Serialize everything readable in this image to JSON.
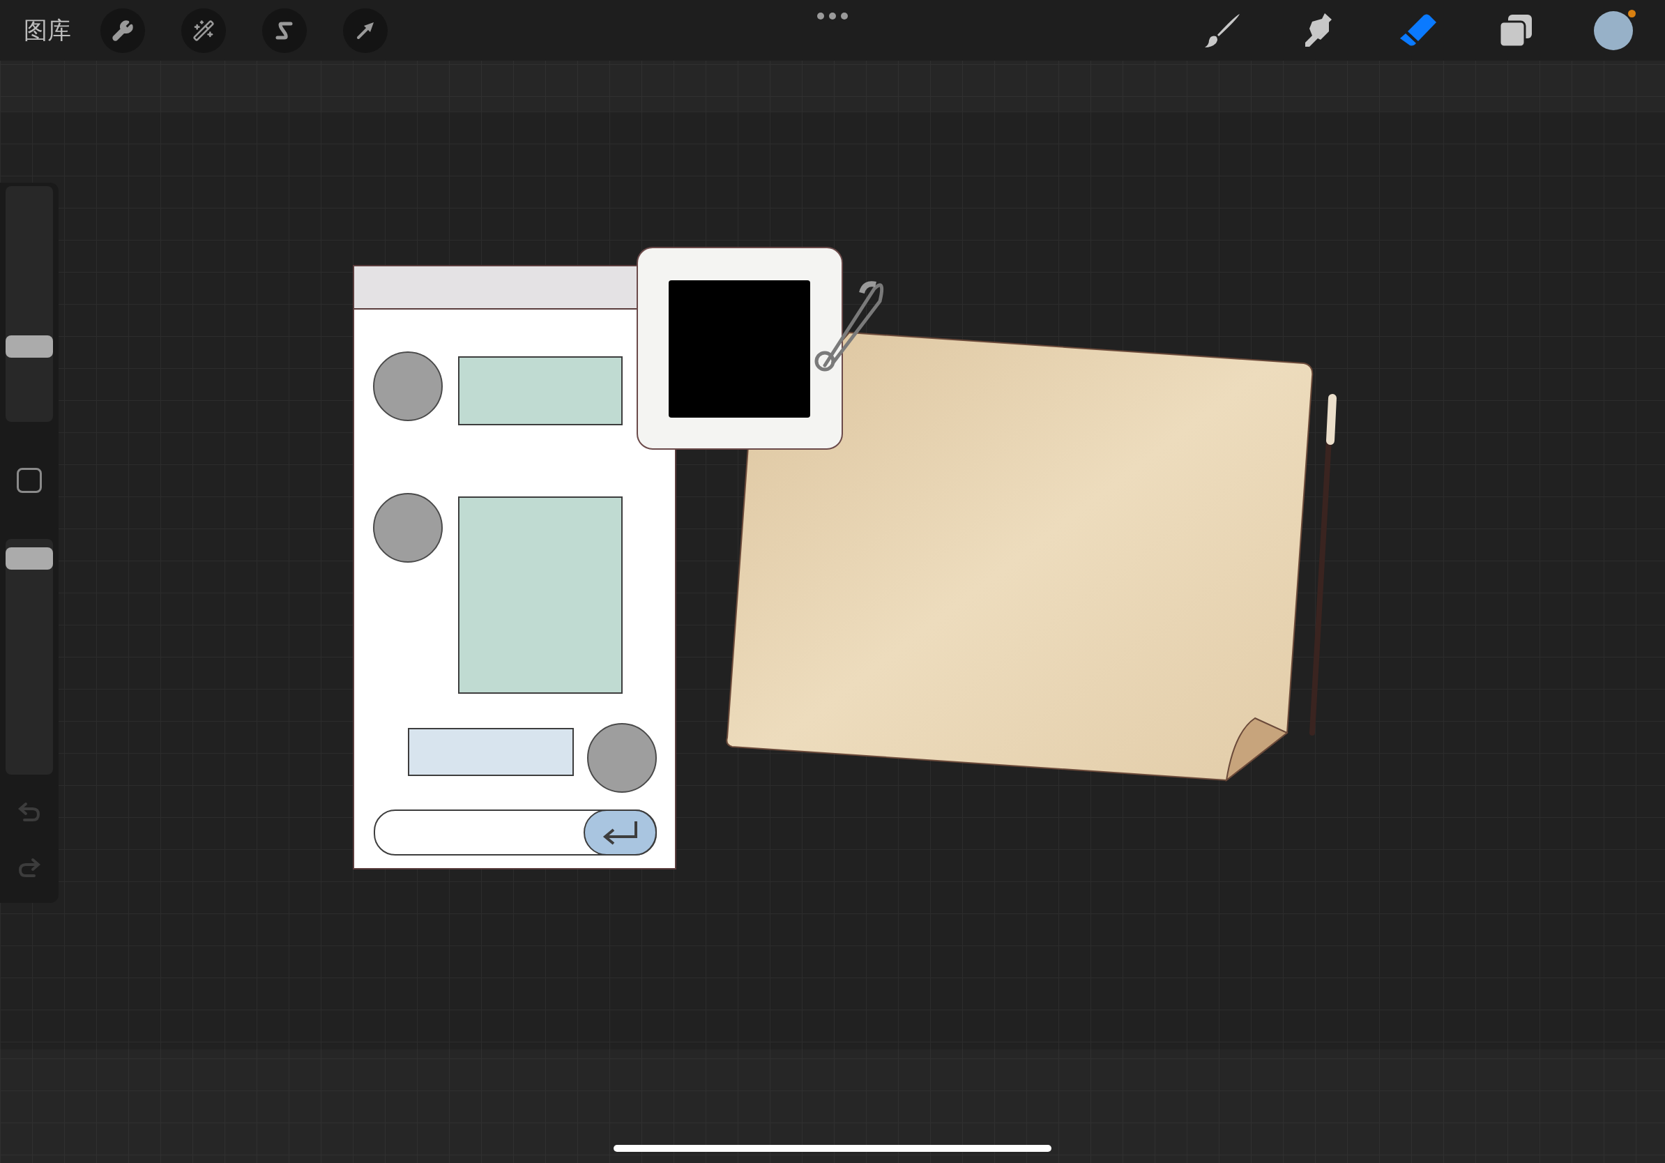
{
  "top_bar": {
    "gallery_label": "图库",
    "actions": [
      {
        "kind": "wrench"
      },
      {
        "kind": "wand"
      },
      {
        "kind": "selection"
      },
      {
        "kind": "transform"
      }
    ],
    "tools": [
      {
        "kind": "brush",
        "selected": false
      },
      {
        "kind": "smudge",
        "selected": false
      },
      {
        "kind": "eraser",
        "selected": true
      },
      {
        "kind": "layers"
      }
    ]
  },
  "sidebar": {
    "size_slider": {
      "level": 0.3
    },
    "opacity_slider": {
      "level": 0.96
    }
  }
}
